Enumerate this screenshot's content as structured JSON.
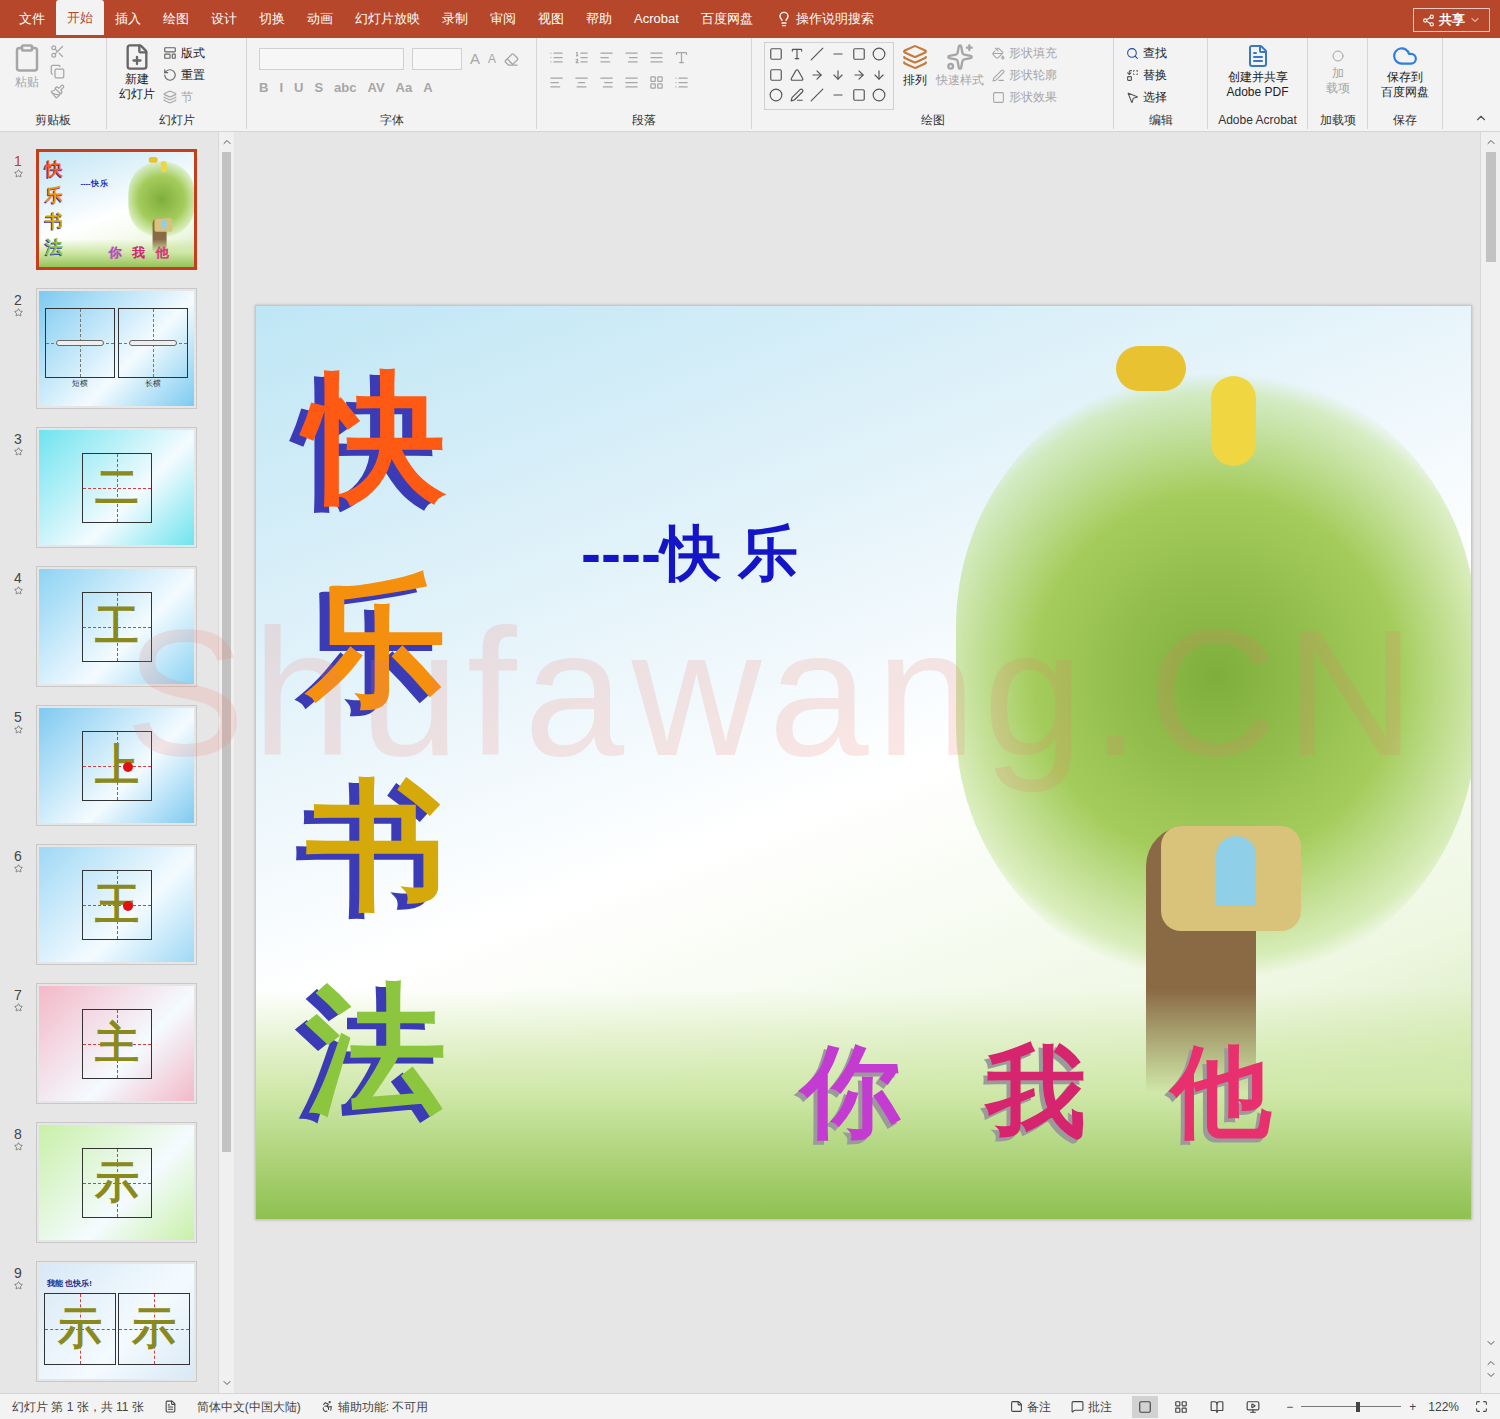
{
  "tabs": [
    {
      "label": "文件",
      "selected": false
    },
    {
      "label": "开始",
      "selected": true
    },
    {
      "label": "插入",
      "selected": false
    },
    {
      "label": "绘图",
      "selected": false
    },
    {
      "label": "设计",
      "selected": false
    },
    {
      "label": "切换",
      "selected": false
    },
    {
      "label": "动画",
      "selected": false
    },
    {
      "label": "幻灯片放映",
      "selected": false
    },
    {
      "label": "录制",
      "selected": false
    },
    {
      "label": "审阅",
      "selected": false
    },
    {
      "label": "视图",
      "selected": false
    },
    {
      "label": "帮助",
      "selected": false
    },
    {
      "label": "Acrobat",
      "selected": false
    },
    {
      "label": "百度网盘",
      "selected": false
    }
  ],
  "search": "操作说明搜索",
  "share": "共享",
  "ribbon": {
    "clipboard": {
      "label": "剪贴板",
      "paste": "粘贴",
      "disabled": true
    },
    "slides": {
      "label": "幻灯片",
      "new_slide": [
        "新建",
        "幻灯片"
      ],
      "layout": "版式",
      "reset": "重置",
      "section": "节",
      "section_disabled": true
    },
    "font": {
      "label": "字体",
      "buttons": [
        "B",
        "I",
        "U",
        "S",
        "abc",
        "AV",
        "Aa",
        "A"
      ],
      "grow": "A",
      "shrink": "A",
      "disabled": true
    },
    "paragraph": {
      "label": "段落",
      "disabled": true
    },
    "drawing": {
      "label": "绘图",
      "arrange": "排列",
      "quick_styles": "快速样式",
      "fill": "形状填充",
      "outline": "形状轮廓",
      "effects": "形状效果",
      "disabled": true
    },
    "editing": {
      "label": "编辑",
      "find": "查找",
      "replace": "替换",
      "select": "选择"
    },
    "acrobat": {
      "label": "Adobe Acrobat",
      "button": [
        "创建并共享",
        "Adobe PDF"
      ]
    },
    "addins": {
      "label": "加载项",
      "button": [
        "加",
        "载项"
      ],
      "disabled": true
    },
    "save": {
      "label": "保存",
      "button": [
        "保存到",
        "百度网盘"
      ]
    }
  },
  "thumbnails": [
    {
      "number": "1",
      "kind": "title",
      "selected": true,
      "color": "#e8f4fb"
    },
    {
      "number": "2",
      "kind": "strokes",
      "labels": [
        "短横",
        "长横"
      ],
      "selected": false,
      "color": "#7ccaf0"
    },
    {
      "number": "3",
      "kind": "char",
      "chars": [
        "二"
      ],
      "dot": false,
      "selected": false,
      "color": "#6fe3ee"
    },
    {
      "number": "4",
      "kind": "char",
      "chars": [
        "工"
      ],
      "dot": false,
      "selected": false,
      "color": "#8dd3f3"
    },
    {
      "number": "5",
      "kind": "char",
      "chars": [
        "上"
      ],
      "dot": true,
      "selected": false,
      "color": "#7fcaf0"
    },
    {
      "number": "6",
      "kind": "char",
      "chars": [
        "王"
      ],
      "dot": true,
      "selected": false,
      "color": "#9fd8f5"
    },
    {
      "number": "7",
      "kind": "char",
      "chars": [
        "主"
      ],
      "dot": false,
      "selected": false,
      "color": "#f3b8c8"
    },
    {
      "number": "8",
      "kind": "char",
      "chars": [
        "示"
      ],
      "dot": false,
      "selected": false,
      "color": "#c8f0a8"
    },
    {
      "number": "9",
      "kind": "char",
      "caption": "我能 也快乐!",
      "chars": [
        "示",
        "示"
      ],
      "dot": false,
      "selected": false,
      "color": "#d8e8f5"
    }
  ],
  "slide": {
    "title": [
      {
        "text": "快",
        "color": "#ff5a14"
      },
      {
        "text": "乐",
        "color": "#f5900f"
      },
      {
        "text": "书",
        "color": "#d6a90a"
      },
      {
        "text": "法",
        "color": "#8cc63f"
      }
    ],
    "subtitle": "----快 乐",
    "words": [
      {
        "text": "你",
        "color": "#c43bd1"
      },
      {
        "text": "我",
        "color": "#d6246e"
      },
      {
        "text": "他",
        "color": "#e8306e"
      }
    ]
  },
  "watermark": "Shufawang.CN",
  "status_bar": {
    "slide_info": "幻灯片 第 1 张，共 11 张",
    "language": "简体中文(中国大陆)",
    "accessibility": "辅助功能: 不可用",
    "notes": "备注",
    "comments": "批注",
    "views": [
      {
        "name": "normal",
        "selected": true
      },
      {
        "name": "sorter",
        "selected": false
      },
      {
        "name": "reading",
        "selected": false
      },
      {
        "name": "slideshow",
        "selected": false
      }
    ],
    "zoom_out": "−",
    "zoom_in": "+",
    "zoom": "122%",
    "zoom_level": 0.55
  }
}
